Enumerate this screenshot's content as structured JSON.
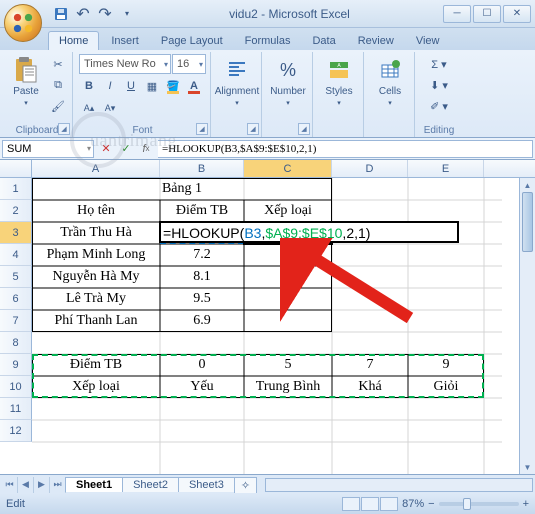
{
  "title": "vidu2 - Microsoft Excel",
  "tabs": [
    "Home",
    "Insert",
    "Page Layout",
    "Formulas",
    "Data",
    "Review",
    "View"
  ],
  "active_tab": 0,
  "ribbon": {
    "clipboard": {
      "label": "Clipboard",
      "paste": "Paste"
    },
    "font": {
      "label": "Font",
      "family": "Times New Ro",
      "size": "16"
    },
    "alignment": {
      "label": "Alignment"
    },
    "number": {
      "label": "Number"
    },
    "styles": {
      "label": "Styles"
    },
    "cells": {
      "label": "Cells"
    },
    "editing": {
      "label": "Editing"
    }
  },
  "name_box": "SUM",
  "formula": "=HLOOKUP(B3,$A$9:$E$10,2,1)",
  "editing_formula": {
    "eq": "=",
    "fn": "HLOOKUP",
    "open": "(",
    "ref1": "B3",
    "c1": ",",
    "ref2": "$A$9:$E$10",
    "c2": ",",
    "a3": "2",
    "c3": ",",
    "a4": "1",
    "close": ")"
  },
  "columns": [
    "A",
    "B",
    "C",
    "D",
    "E"
  ],
  "row_headers": [
    "1",
    "2",
    "3",
    "4",
    "5",
    "6",
    "7",
    "8",
    "9",
    "10",
    "11",
    "12"
  ],
  "table1": {
    "title": "Bảng 1",
    "headers": [
      "Họ tên",
      "Điểm TB",
      "Xếp loại"
    ],
    "rows": [
      {
        "name": "Trần Thu Hà",
        "score": ""
      },
      {
        "name": "Phạm Minh Long",
        "score": "7.2"
      },
      {
        "name": "Nguyễn Hà My",
        "score": "8.1"
      },
      {
        "name": "Lê Trà My",
        "score": "9.5"
      },
      {
        "name": "Phí Thanh Lan",
        "score": "6.9"
      }
    ]
  },
  "table2": {
    "r1": [
      "Điểm TB",
      "0",
      "5",
      "7",
      "9"
    ],
    "r2": [
      "Xếp loại",
      "Yếu",
      "Trung Bình",
      "Khá",
      "Giỏi"
    ]
  },
  "sheets": [
    "Sheet1",
    "Sheet2",
    "Sheet3"
  ],
  "status": "Edit",
  "zoom": "87%",
  "watermark": "uantrimang"
}
